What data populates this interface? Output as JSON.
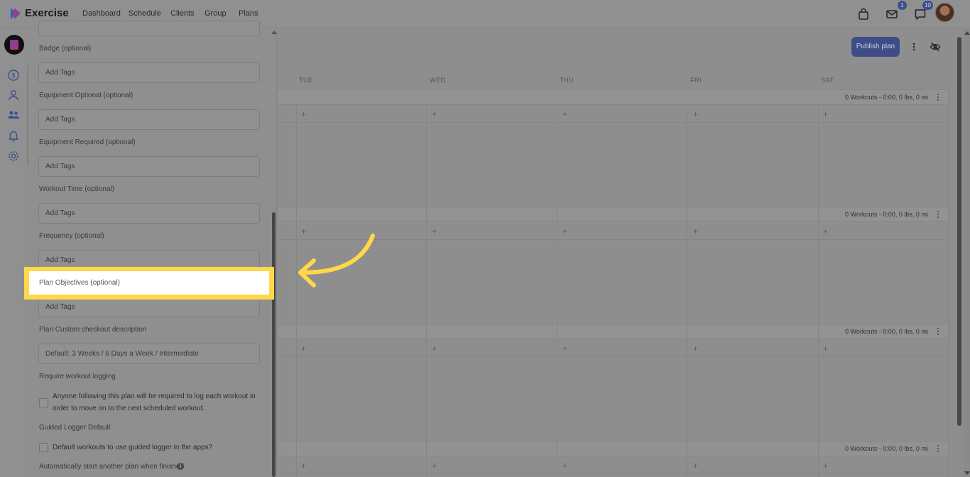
{
  "app": {
    "name": "Exercise"
  },
  "nav": [
    "Dashboard",
    "Schedule",
    "Clients",
    "Group",
    "Plans"
  ],
  "badges": {
    "mail": "1",
    "chat": "10"
  },
  "form": {
    "badge_label": "Badge (optional)",
    "equip_opt_label": "Equipment Optional (optional)",
    "equip_req_label": "Equipment Required (optional)",
    "workout_time_label": "Workout Time (optional)",
    "frequency_label": "Frequency (optional)",
    "objectives_label": "Plan Objectives (optional)",
    "tags_placeholder": "Add Tags",
    "checkout_label": "Plan Custom checkout description",
    "checkout_value": "Default: 3 Weeks / 6 Days a Week / Intermediate",
    "logging_label": "Require workout logging",
    "logging_text": "Anyone following this plan will be required to log each workout in order to move on to the next scheduled workout.",
    "guided_label": "Guided Logger Default",
    "guided_text": "Default workouts to use guided logger in the apps?",
    "auto_label": "Automatically start another plan when finished"
  },
  "calendar": {
    "publish_label": "Publish plan",
    "days": [
      "TUE",
      "WED",
      "THU",
      "FRI",
      "SAT"
    ],
    "week_summary": "0 Workouts - 0:00, 0 lbs, 0 mi",
    "plus": "+"
  },
  "colors": {
    "highlight": "#ffd84a",
    "publish_bg": "#3e4d86",
    "overlay_gray": "#8e8e8e"
  }
}
